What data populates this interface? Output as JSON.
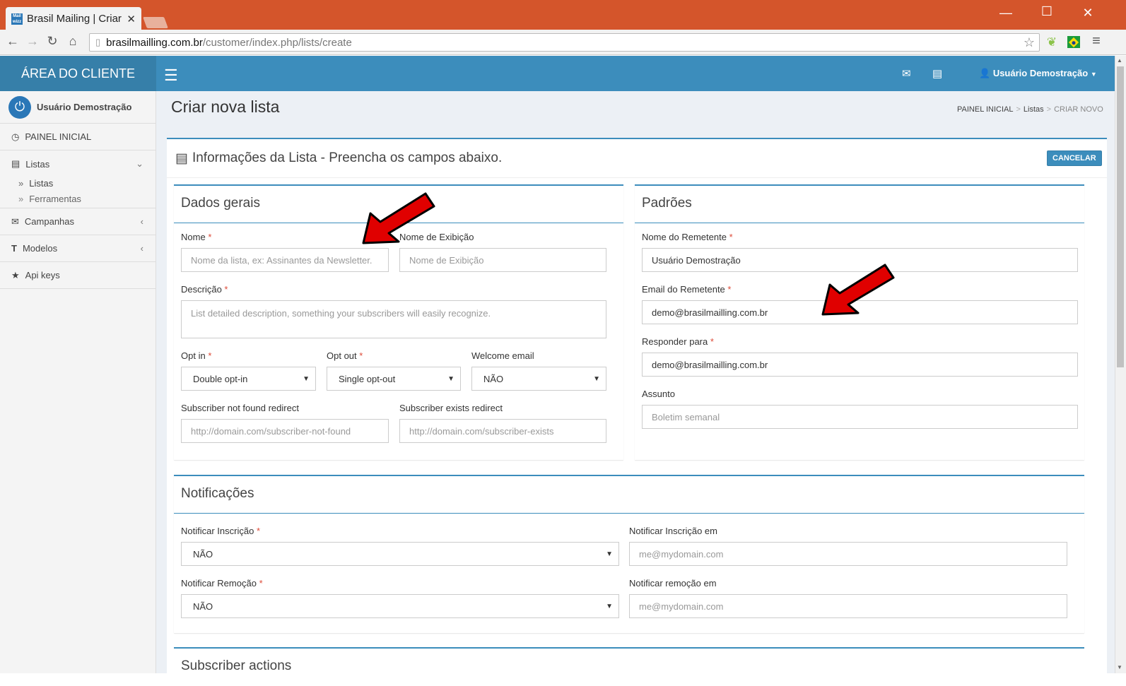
{
  "browser": {
    "tab_title": "Brasil Mailing | Criar",
    "favicon_text": "Mail wizz",
    "url_host": "brasilmailling.com.br",
    "url_path": "/customer/index.php/lists/create"
  },
  "header": {
    "brand": "ÁREA DO CLIENTE",
    "user_menu": "Usuário Demostração"
  },
  "sidebar": {
    "user_name": "Usuário Demostração",
    "items": [
      {
        "label": "PAINEL INICIAL",
        "icon": "dashboard-icon"
      },
      {
        "label": "Listas",
        "icon": "list-icon"
      },
      {
        "label": "Campanhas",
        "icon": "envelope-icon"
      },
      {
        "label": "Modelos",
        "icon": "text-icon"
      },
      {
        "label": "Api keys",
        "icon": "star-icon"
      }
    ],
    "sub_items": [
      "Listas",
      "Ferramentas"
    ]
  },
  "page": {
    "title": "Criar nova lista",
    "breadcrumb": [
      "PAINEL INICIAL",
      "Listas",
      "CRIAR NOVO"
    ],
    "box_title": "Informações da Lista - Preencha os campos abaixo.",
    "cancel_label": "CANCELAR"
  },
  "general": {
    "title": "Dados gerais",
    "name_label": "Nome",
    "name_placeholder": "Nome da lista, ex: Assinantes da Newsletter.",
    "display_label": "Nome de Exibição",
    "display_placeholder": "Nome de Exibição",
    "desc_label": "Descrição",
    "desc_placeholder": "List detailed description, something your subscribers will easily recognize.",
    "optin_label": "Opt in",
    "optin_value": "Double opt-in",
    "optout_label": "Opt out",
    "optout_value": "Single opt-out",
    "welcome_label": "Welcome email",
    "welcome_value": "NÃO",
    "notfound_label": "Subscriber not found redirect",
    "notfound_placeholder": "http://domain.com/subscriber-not-found",
    "exists_label": "Subscriber exists redirect",
    "exists_placeholder": "http://domain.com/subscriber-exists"
  },
  "defaults": {
    "title": "Padrões",
    "from_name_label": "Nome do Remetente",
    "from_name_value": "Usuário  Demostração",
    "from_email_label": "Email do Remetente",
    "from_email_value": "demo@brasilmailling.com.br",
    "reply_label": "Responder para",
    "reply_value": "demo@brasilmailling.com.br",
    "subject_label": "Assunto",
    "subject_placeholder": "Boletim semanal"
  },
  "notifications": {
    "title": "Notificações",
    "sub_label": "Notificar Inscrição",
    "sub_value": "NÃO",
    "sub_email_label": "Notificar Inscrição em",
    "sub_email_placeholder": "me@mydomain.com",
    "unsub_label": "Notificar Remoção",
    "unsub_value": "NÃO",
    "unsub_email_label": "Notificar remoção em",
    "unsub_email_placeholder": "me@mydomain.com"
  },
  "actions": {
    "title": "Subscriber actions"
  },
  "colors": {
    "brand": "#367fa9",
    "header": "#3c8dbc",
    "titlebar": "#d4552b",
    "required": "#dd4b39",
    "arrow": "#e00000"
  }
}
